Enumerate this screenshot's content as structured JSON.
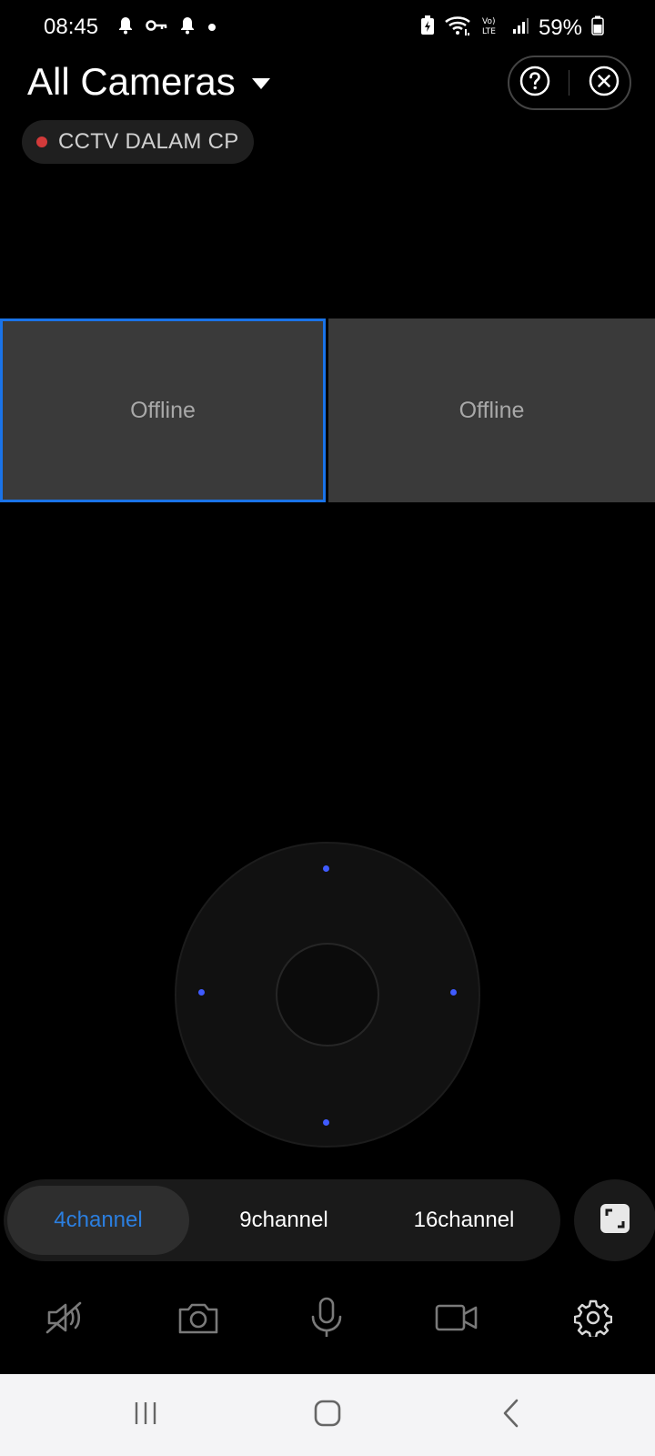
{
  "status_bar": {
    "time": "08:45",
    "left_icons": [
      "notification-bell-icon",
      "vpn-key-icon",
      "notification-bell-icon",
      "dot-icon"
    ],
    "right_icons": [
      "battery-saver-icon",
      "wifi-icon",
      "volte-icon",
      "signal-icon",
      "battery-icon"
    ],
    "battery_percent": "59%"
  },
  "header": {
    "title": "All Cameras",
    "help_icon": "help-icon",
    "close_icon": "close-circle-icon"
  },
  "device_chip": {
    "label": "CCTV DALAM CP",
    "status_color": "#d23a3a"
  },
  "camera_grid": {
    "tiles": [
      {
        "status": "Offline",
        "selected": true
      },
      {
        "status": "Offline",
        "selected": false
      }
    ],
    "selection_color": "#1a73e8"
  },
  "ptz": {
    "directions": [
      "up",
      "left",
      "right",
      "down"
    ],
    "indicator_color": "#3f5bff"
  },
  "channel_selector": {
    "options": [
      {
        "label": "4channel",
        "active": true
      },
      {
        "label": "9channel",
        "active": false
      },
      {
        "label": "16channel",
        "active": false
      }
    ],
    "active_color": "#2b7fe0",
    "fullscreen_icon": "fullscreen-icon"
  },
  "toolbar": {
    "items": [
      "mute-speaker-icon",
      "camera-snapshot-icon",
      "microphone-icon",
      "video-record-icon",
      "settings-gear-icon"
    ]
  },
  "nav_bar": {
    "items": [
      "recent-apps-icon",
      "home-icon",
      "back-icon"
    ]
  }
}
